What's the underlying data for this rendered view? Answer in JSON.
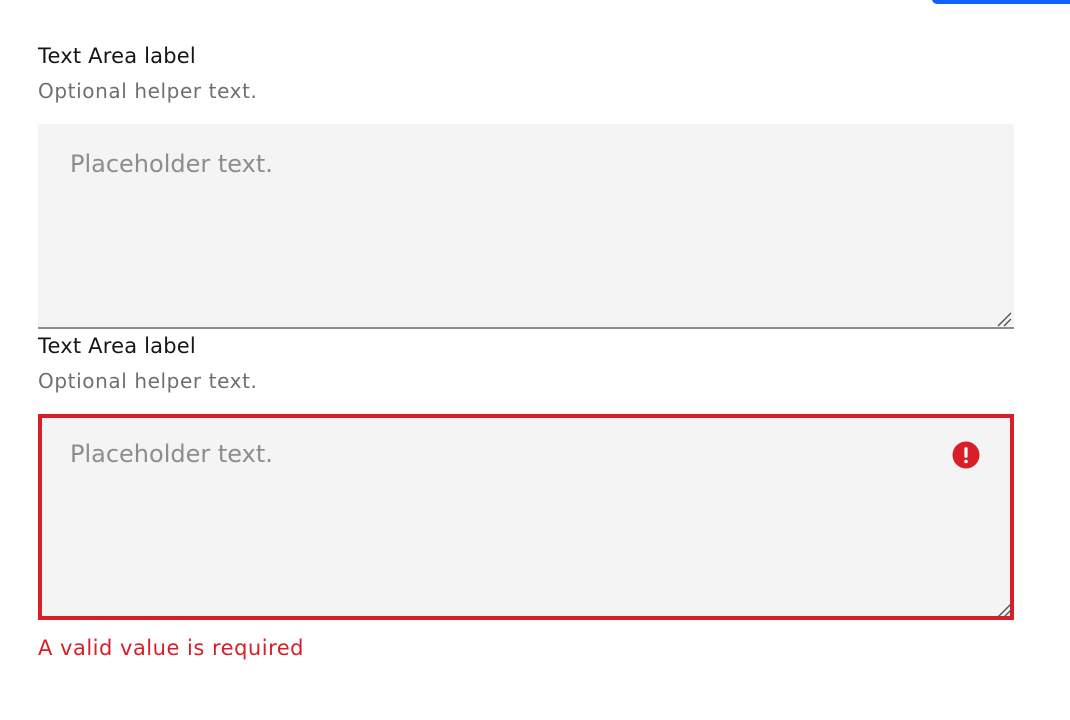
{
  "fields": [
    {
      "label": "Text Area label",
      "helper": "Optional helper text.",
      "placeholder": "Placeholder text.",
      "value": "",
      "state": "default"
    },
    {
      "label": "Text Area label",
      "helper": "Optional helper text.",
      "placeholder": "Placeholder text.",
      "value": "",
      "state": "invalid",
      "error": "A valid value is required",
      "icon": "warning-filled-icon"
    }
  ],
  "colors": {
    "field_background": "#f4f4f4",
    "error": "#da1e28",
    "accent": "#0f62fe"
  }
}
